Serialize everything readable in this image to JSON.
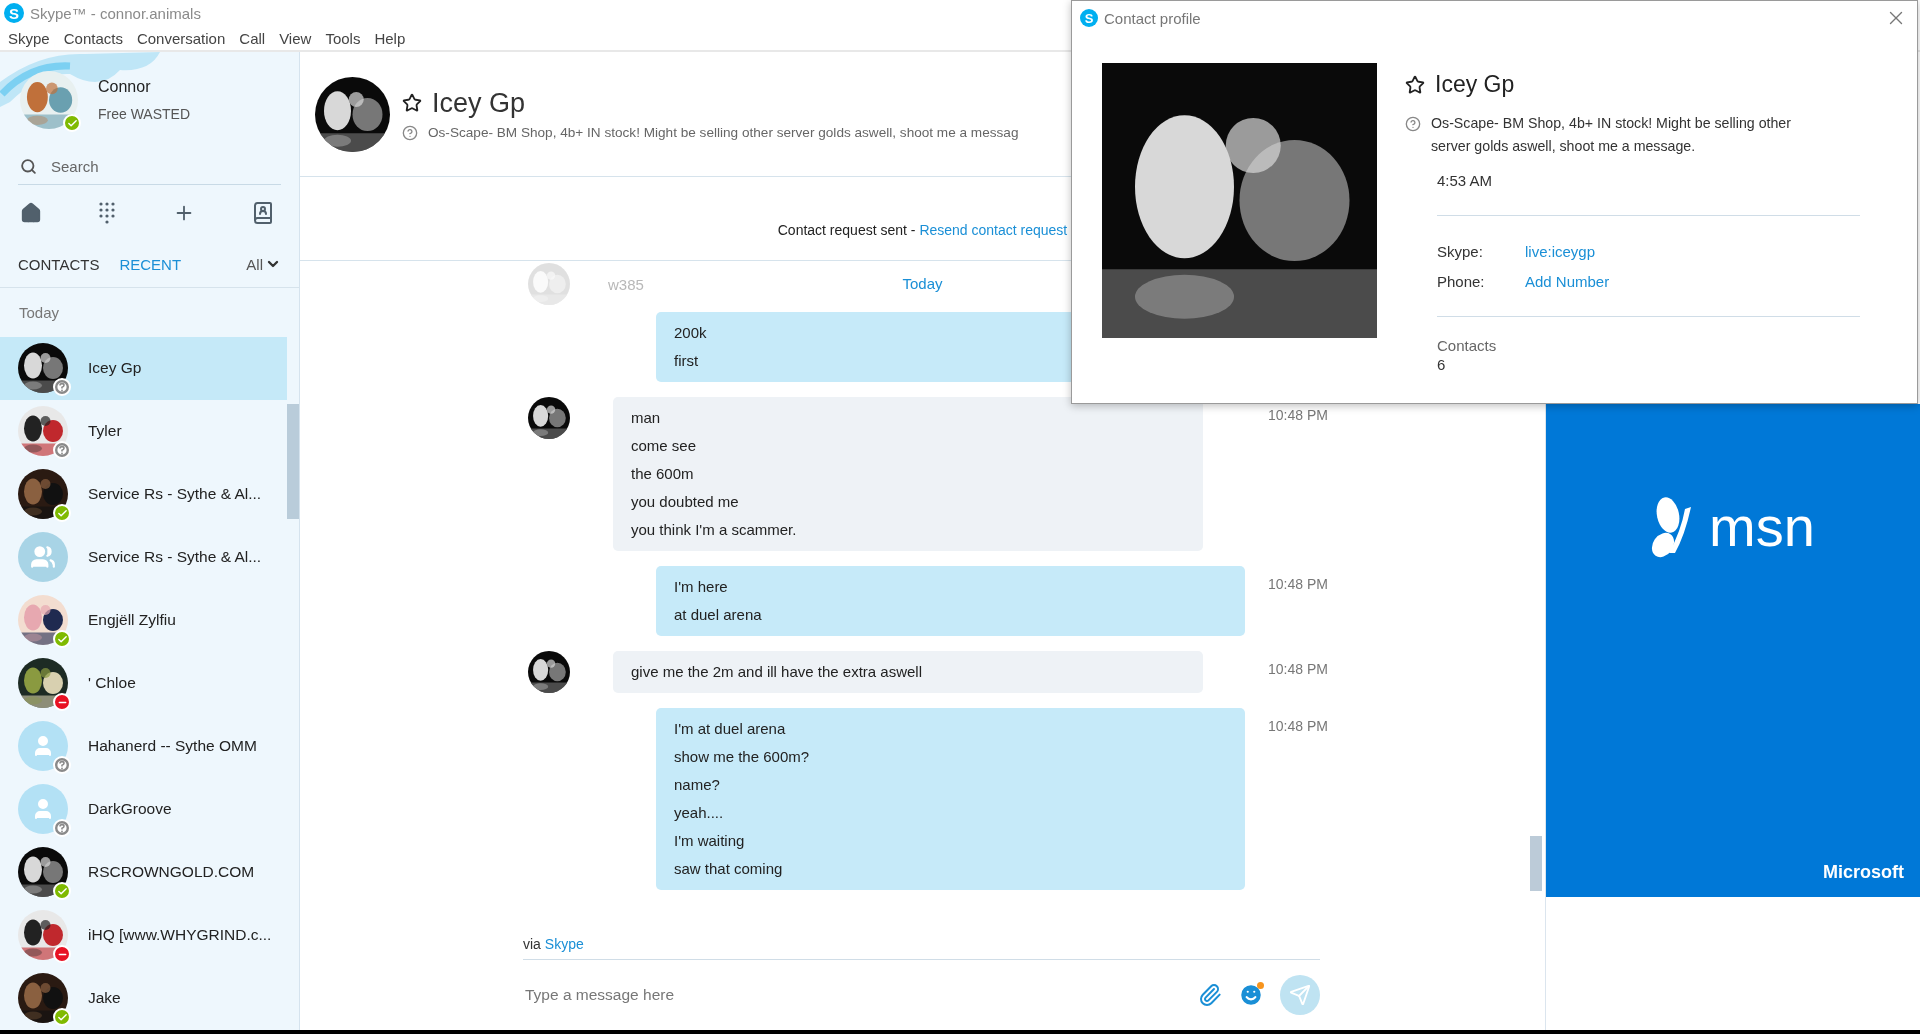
{
  "title_bar": {
    "logo": "S",
    "title": "Skype™ - connor.animals"
  },
  "menu": [
    "Skype",
    "Contacts",
    "Conversation",
    "Call",
    "View",
    "Tools",
    "Help"
  ],
  "profile": {
    "name": "Connor",
    "mood": "Free WASTED",
    "color": "#7fba00"
  },
  "search": {
    "placeholder": "Search"
  },
  "tabs": [
    {
      "label": "CONTACTS",
      "selected": false
    },
    {
      "label": "RECENT",
      "selected": true
    }
  ],
  "filter": {
    "label": "All"
  },
  "section": "Today",
  "contacts": [
    {
      "name": "Icey Gp",
      "kind": "picture",
      "color": "#8a8a8a",
      "selected": true
    },
    {
      "name": "Tyler",
      "kind": "picture",
      "color": "#8a8a8a",
      "selected": false
    },
    {
      "name": "Service Rs - Sythe & Al...",
      "kind": "picture",
      "color": "#7fba00",
      "selected": false
    },
    {
      "name": "Service Rs - Sythe & Al...",
      "kind": "group",
      "selected": false
    },
    {
      "name": "Engjëll Zylfiu",
      "kind": "picture",
      "color": "#7fba00",
      "selected": false
    },
    {
      "name": "' Chloe",
      "kind": "picture",
      "color": "#e81123",
      "selected": false
    },
    {
      "name": "Hahanerd -- Sythe OMM",
      "kind": "person",
      "color": "#8a8a8a",
      "selected": false
    },
    {
      "name": "DarkGroove",
      "kind": "person",
      "color": "#8a8a8a",
      "selected": false
    },
    {
      "name": "RSCROWNGOLD.COM",
      "kind": "picture",
      "color": "#7fba00",
      "selected": false
    },
    {
      "name": "iHQ [www.WHYGRIND.c...",
      "kind": "picture",
      "color": "#e81123",
      "selected": false
    },
    {
      "name": "Jake",
      "kind": "picture",
      "color": "#7fba00",
      "selected": false
    }
  ],
  "conversation": {
    "name": "Icey Gp",
    "mood": "Os-Scape- BM Shop, 4b+ IN stock! Might be selling other server golds aswell, shoot me a messag",
    "notice": "Contact request sent - ",
    "notice_link": "Resend contact request",
    "ghost_text": "w385",
    "date": "Today",
    "messages": [
      {
        "kind": "sent",
        "lines": [
          "200k",
          "first"
        ]
      },
      {
        "kind": "received",
        "lines": [
          "man",
          "come see",
          "the 600m",
          "you doubted me",
          "you think I'm a scammer."
        ],
        "time": "10:48 PM"
      },
      {
        "kind": "sent",
        "lines": [
          "I'm here",
          "at duel arena"
        ],
        "time": "10:48 PM"
      },
      {
        "kind": "received",
        "lines": [
          "give me the 2m and ill have the extra aswell"
        ],
        "time": "10:48 PM"
      },
      {
        "kind": "sent",
        "lines": [
          "I'm at duel arena",
          "show me the 600m?",
          "name?",
          "yeah....",
          "I'm waiting",
          "saw that coming"
        ],
        "time": "10:48 PM"
      }
    ],
    "via": "via ",
    "via_link": "Skype",
    "composer": {
      "placeholder": "Type a message here"
    }
  },
  "ad": {
    "brand": "msn",
    "company": "Microsoft"
  },
  "profile_popup": {
    "logo": "S",
    "title": "Contact profile",
    "name": "Icey Gp",
    "mood": "Os-Scape- BM Shop, 4b+ IN stock! Might be selling other server golds aswell, shoot me a message.",
    "local_time": "4:53 AM",
    "fields": [
      {
        "label": "Skype:",
        "value": "live:iceygp"
      },
      {
        "label": "Phone:",
        "value": "Add Number"
      }
    ],
    "contacts_label": "Contacts",
    "contacts_count": "6"
  }
}
